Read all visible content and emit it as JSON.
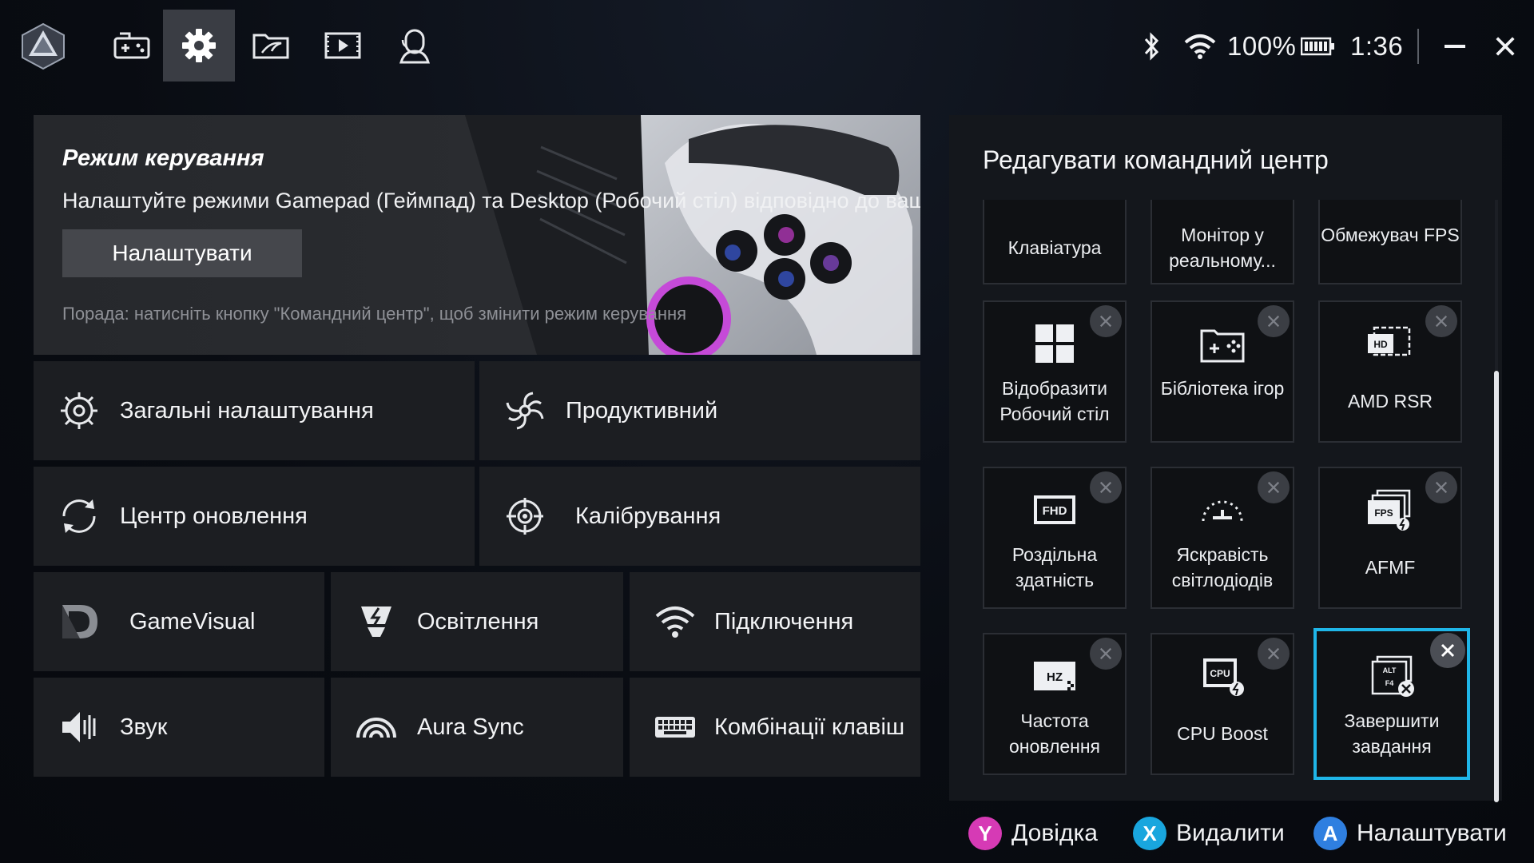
{
  "topbar": {
    "nav_tabs": [
      {
        "name": "game-controller-plus-icon"
      },
      {
        "name": "gear-icon",
        "active": true
      },
      {
        "name": "rog-library-icon"
      },
      {
        "name": "media-play-icon"
      },
      {
        "name": "user-support-icon"
      }
    ],
    "status": {
      "battery_percent": "100%",
      "time": "1:36"
    }
  },
  "banner": {
    "title": "Режим керування",
    "description": "Налаштуйте режими Gamepad (Геймпад) та Desktop (Робочий стіл) відповідно до ваших потреб",
    "button_label": "Налаштувати",
    "tip": "Порада: натисніть кнопку \"Командний центр\", щоб змінити режим керування"
  },
  "tiles": [
    {
      "label": "Загальні налаштування",
      "icon": "gear-outline-icon"
    },
    {
      "label": "Продуктивний",
      "icon": "performance-fan-icon"
    },
    {
      "label": "Центр оновлення",
      "icon": "refresh-icon"
    },
    {
      "label": "Калібрування",
      "icon": "crosshair-icon"
    },
    {
      "label": "GameVisual",
      "icon": "gamevisual-icon"
    },
    {
      "label": "Освітлення",
      "icon": "lighting-icon"
    },
    {
      "label": "Підключення",
      "icon": "wifi-icon"
    },
    {
      "label": "Звук",
      "icon": "speaker-icon"
    },
    {
      "label": "Aura Sync",
      "icon": "aura-sync-icon"
    },
    {
      "label": "Комбінації клавіш",
      "icon": "keyboard-icon"
    }
  ],
  "command_center": {
    "title": "Редагувати командний центр",
    "cards": [
      {
        "label": "Клавіатура",
        "icon": "keyboard-icon",
        "removable": false
      },
      {
        "label": "Монітор у реальному...",
        "icon": "monitor-icon",
        "removable": false
      },
      {
        "label": "Обмежувач FPS",
        "icon": "fps-limit-icon",
        "removable": false
      },
      {
        "label": "Відобразити Робочий стіл",
        "icon": "windows-icon",
        "removable": true
      },
      {
        "label": "Бібліотека ігор",
        "icon": "game-library-icon",
        "removable": true
      },
      {
        "label": "AMD RSR",
        "icon": "hd-icon",
        "removable": true
      },
      {
        "label": "Роздільна здатність",
        "icon": "fhd-icon",
        "removable": true
      },
      {
        "label": "Яскравість світлодіодів",
        "icon": "led-brightness-icon",
        "removable": true
      },
      {
        "label": "AFMF",
        "icon": "fps-frames-icon",
        "removable": true
      },
      {
        "label": "Частота оновлення",
        "icon": "hz-icon",
        "removable": true
      },
      {
        "label": "CPU Boost",
        "icon": "cpu-boost-icon",
        "removable": true
      },
      {
        "label": "Завершити завдання",
        "icon": "alt-f4-icon",
        "removable": true,
        "selected": true
      }
    ]
  },
  "hints": [
    {
      "button": "Y",
      "label": "Довідка",
      "color": "#d63ab5"
    },
    {
      "button": "X",
      "label": "Видалити",
      "color": "#19a6de"
    },
    {
      "button": "A",
      "label": "Налаштувати",
      "color": "#2f7fe0"
    }
  ],
  "colors": {
    "accent": "#1fb6e8",
    "tile_bg": "#1c1e22",
    "panel_bg": "#14171c"
  }
}
